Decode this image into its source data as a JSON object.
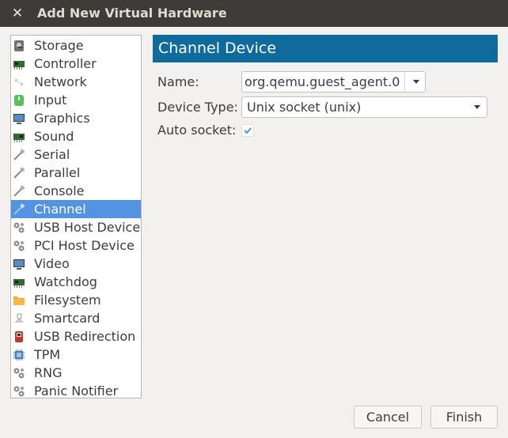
{
  "window": {
    "title": "Add New Virtual Hardware",
    "close_glyph": "✕"
  },
  "sidebar": {
    "items": [
      {
        "label": "Storage",
        "icon": "storage-icon"
      },
      {
        "label": "Controller",
        "icon": "controller-icon"
      },
      {
        "label": "Network",
        "icon": "network-icon"
      },
      {
        "label": "Input",
        "icon": "input-icon"
      },
      {
        "label": "Graphics",
        "icon": "graphics-icon"
      },
      {
        "label": "Sound",
        "icon": "sound-icon"
      },
      {
        "label": "Serial",
        "icon": "serial-icon"
      },
      {
        "label": "Parallel",
        "icon": "parallel-icon"
      },
      {
        "label": "Console",
        "icon": "console-icon"
      },
      {
        "label": "Channel",
        "icon": "channel-icon",
        "selected": true
      },
      {
        "label": "USB Host Device",
        "icon": "usb-host-device-icon"
      },
      {
        "label": "PCI Host Device",
        "icon": "pci-host-device-icon"
      },
      {
        "label": "Video",
        "icon": "video-icon"
      },
      {
        "label": "Watchdog",
        "icon": "watchdog-icon"
      },
      {
        "label": "Filesystem",
        "icon": "filesystem-icon"
      },
      {
        "label": "Smartcard",
        "icon": "smartcard-icon"
      },
      {
        "label": "USB Redirection",
        "icon": "usb-redirection-icon"
      },
      {
        "label": "TPM",
        "icon": "tpm-icon"
      },
      {
        "label": "RNG",
        "icon": "rng-icon"
      },
      {
        "label": "Panic Notifier",
        "icon": "panic-notifier-icon"
      }
    ]
  },
  "main": {
    "header": "Channel Device",
    "name_label": "Name:",
    "name_value": "org.qemu.guest_agent.0",
    "device_type_label": "Device Type:",
    "device_type_value": "Unix socket (unix)",
    "auto_socket_label": "Auto socket:",
    "auto_socket_checked": true
  },
  "buttons": {
    "cancel": "Cancel",
    "finish": "Finish"
  },
  "colors": {
    "header_bg": "#0f6b9b",
    "selection_bg": "#5294e2",
    "titlebar_bg": "#3d3c38"
  }
}
